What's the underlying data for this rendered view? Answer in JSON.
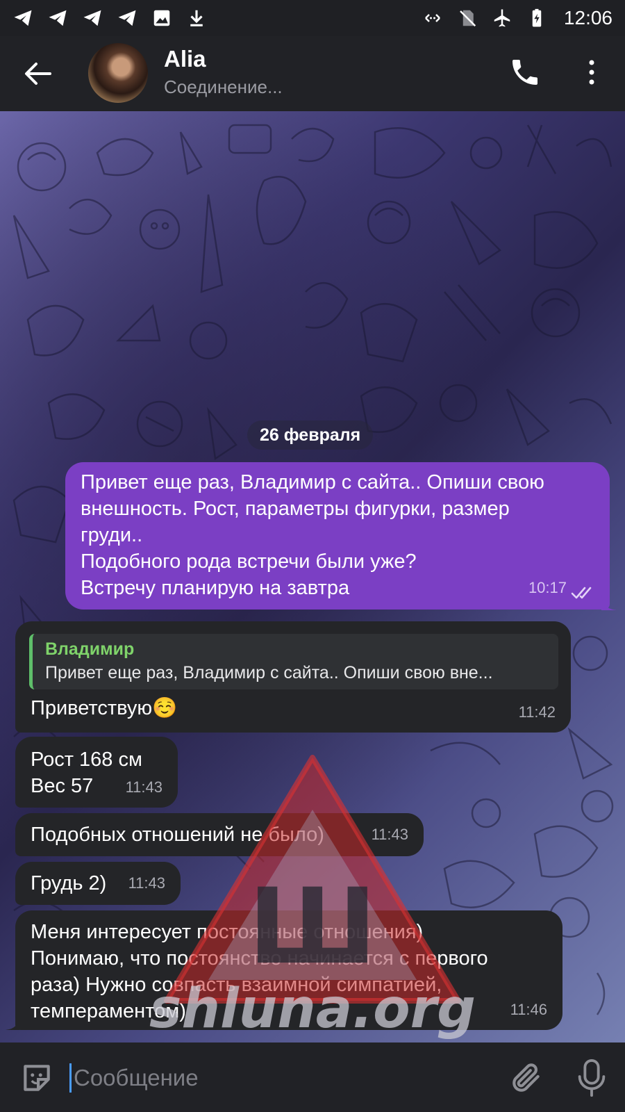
{
  "status_bar": {
    "time": "12:06",
    "left_icons": [
      "telegram-icon",
      "telegram-icon",
      "telegram-icon",
      "telegram-icon",
      "image-icon",
      "download-icon"
    ],
    "right_icons": [
      "data-transfer-icon",
      "no-sim-icon",
      "airplane-icon",
      "battery-charging-icon"
    ]
  },
  "header": {
    "contact_name": "Alia",
    "status": "Соединение...",
    "icons": [
      "back-arrow-icon",
      "phone-icon",
      "more-vertical-icon"
    ]
  },
  "chat": {
    "date_separator": "26 февраля",
    "messages": [
      {
        "direction": "outgoing",
        "lines": [
          "Привет еще раз, Владимир с сайта.. Опиши свою",
          "внешность. Рост, параметры фигурки, размер",
          "груди..",
          "Подобного рода встречи были уже?",
          "Встречу планирую на завтра"
        ],
        "time": "10:17",
        "status": "read"
      },
      {
        "direction": "incoming",
        "reply_to": {
          "author": "Владимир",
          "text": "Привет еще раз, Владимир с сайта.. Опиши свою вне..."
        },
        "lines": [
          "Приветствую☺️"
        ],
        "time": "11:42"
      },
      {
        "direction": "incoming",
        "lines": [
          "Рост 168 см",
          "Вес 57"
        ],
        "time": "11:43"
      },
      {
        "direction": "incoming",
        "lines": [
          "Подобных отношений не было)"
        ],
        "time": "11:43"
      },
      {
        "direction": "incoming",
        "lines": [
          "Грудь 2)"
        ],
        "time": "11:43"
      },
      {
        "direction": "incoming",
        "lines": [
          "Меня интересует постоянные отношения)",
          "Понимаю, что постоянство начинается с первого",
          "раза) Нужно совпасть взаимной симпатией,",
          "темпераментом)"
        ],
        "time": "11:46"
      }
    ]
  },
  "watermark": {
    "glyph": "Ш",
    "text": "shluna.org"
  },
  "input_bar": {
    "placeholder": "Сообщение",
    "icons": [
      "sticker-icon",
      "attach-icon",
      "microphone-icon"
    ]
  },
  "colors": {
    "outgoing_bubble": "#7b3fc4",
    "incoming_bubble": "#242528",
    "reply_accent": "#5fbf6a",
    "header_bg": "#212226"
  }
}
